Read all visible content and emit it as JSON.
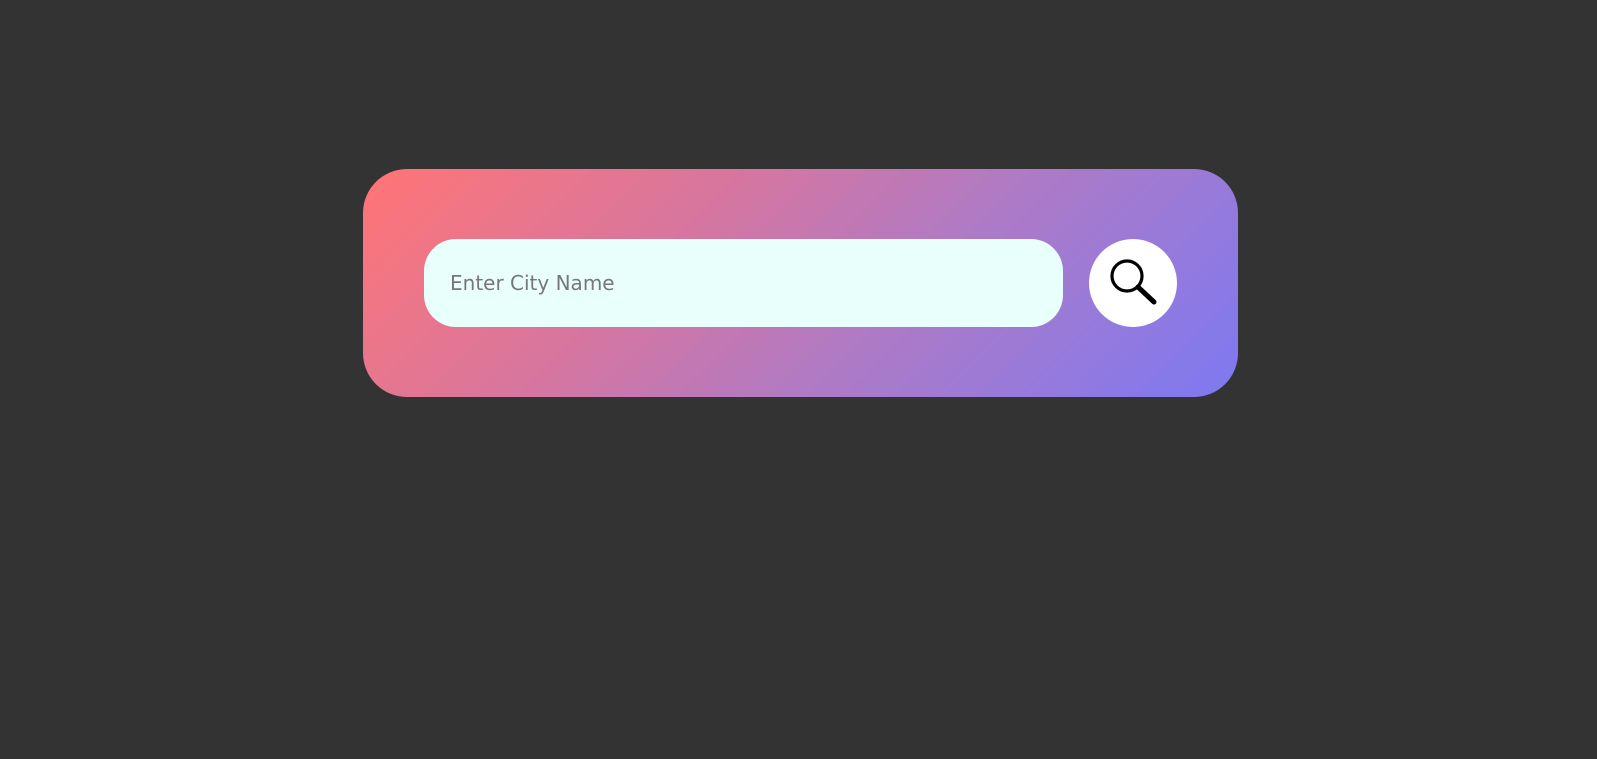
{
  "search": {
    "placeholder": "Enter City Name",
    "value": "",
    "button_icon": "search-icon"
  },
  "colors": {
    "background": "#333333",
    "gradient_start": "#ff7575",
    "gradient_end": "#7d79f2",
    "input_background": "#e9fffc",
    "button_background": "#ffffff"
  }
}
